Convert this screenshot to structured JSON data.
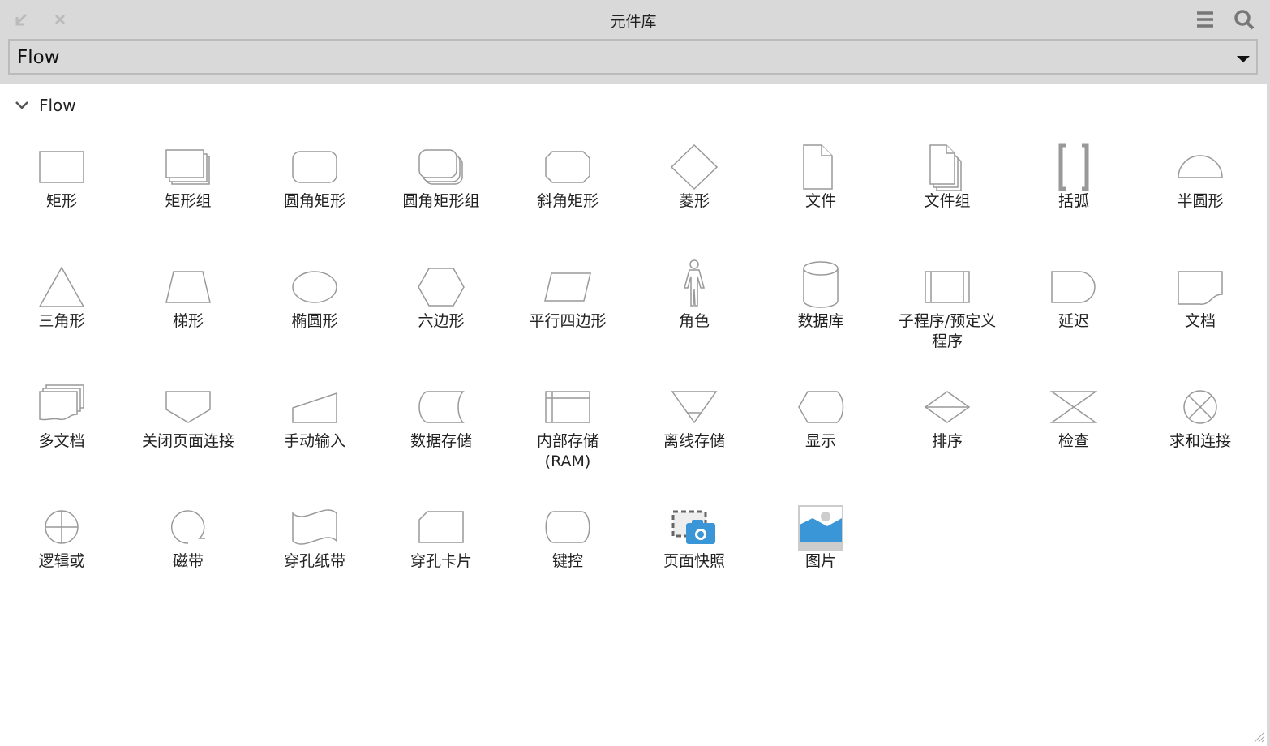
{
  "window": {
    "title": "元件库",
    "icons": [
      "collapse-arrow-icon",
      "close-icon",
      "menu-icon",
      "search-icon"
    ]
  },
  "library_select": {
    "value": "Flow"
  },
  "section": {
    "label": "Flow"
  },
  "items": [
    {
      "label": "矩形",
      "icon": "rect"
    },
    {
      "label": "矩形组",
      "icon": "rectgroup"
    },
    {
      "label": "圆角矩形",
      "icon": "roundrect"
    },
    {
      "label": "圆角矩形组",
      "icon": "roundrectgroup"
    },
    {
      "label": "斜角矩形",
      "icon": "bevel"
    },
    {
      "label": "菱形",
      "icon": "diamond"
    },
    {
      "label": "文件",
      "icon": "file"
    },
    {
      "label": "文件组",
      "icon": "filegroup"
    },
    {
      "label": "括弧",
      "icon": "bracket"
    },
    {
      "label": "半圆形",
      "icon": "semicircle"
    },
    {
      "label": "三角形",
      "icon": "triangle"
    },
    {
      "label": "梯形",
      "icon": "trapezoid"
    },
    {
      "label": "椭圆形",
      "icon": "ellipse"
    },
    {
      "label": "六边形",
      "icon": "hexagon"
    },
    {
      "label": "平行四边形",
      "icon": "parallelogram"
    },
    {
      "label": "角色",
      "icon": "actor"
    },
    {
      "label": "数据库",
      "icon": "database"
    },
    {
      "label": "子程序/预定义程序",
      "icon": "subroutine"
    },
    {
      "label": "延迟",
      "icon": "delay"
    },
    {
      "label": "文档",
      "icon": "document"
    },
    {
      "label": "多文档",
      "icon": "multidoc"
    },
    {
      "label": "关闭页面连接",
      "icon": "offpage"
    },
    {
      "label": "手动输入",
      "icon": "manualinput"
    },
    {
      "label": "数据存储",
      "icon": "datastore"
    },
    {
      "label": "内部存储(RAM)",
      "icon": "internal"
    },
    {
      "label": "离线存储",
      "icon": "offline"
    },
    {
      "label": "显示",
      "icon": "display"
    },
    {
      "label": "排序",
      "icon": "sort"
    },
    {
      "label": "检查",
      "icon": "collate"
    },
    {
      "label": "求和连接",
      "icon": "sumjunction"
    },
    {
      "label": "逻辑或",
      "icon": "or"
    },
    {
      "label": "磁带",
      "icon": "tape"
    },
    {
      "label": "穿孔纸带",
      "icon": "punchtape"
    },
    {
      "label": "穿孔卡片",
      "icon": "card"
    },
    {
      "label": "键控",
      "icon": "terminator"
    },
    {
      "label": "页面快照",
      "icon": "snapshot"
    },
    {
      "label": "图片",
      "icon": "image"
    }
  ]
}
